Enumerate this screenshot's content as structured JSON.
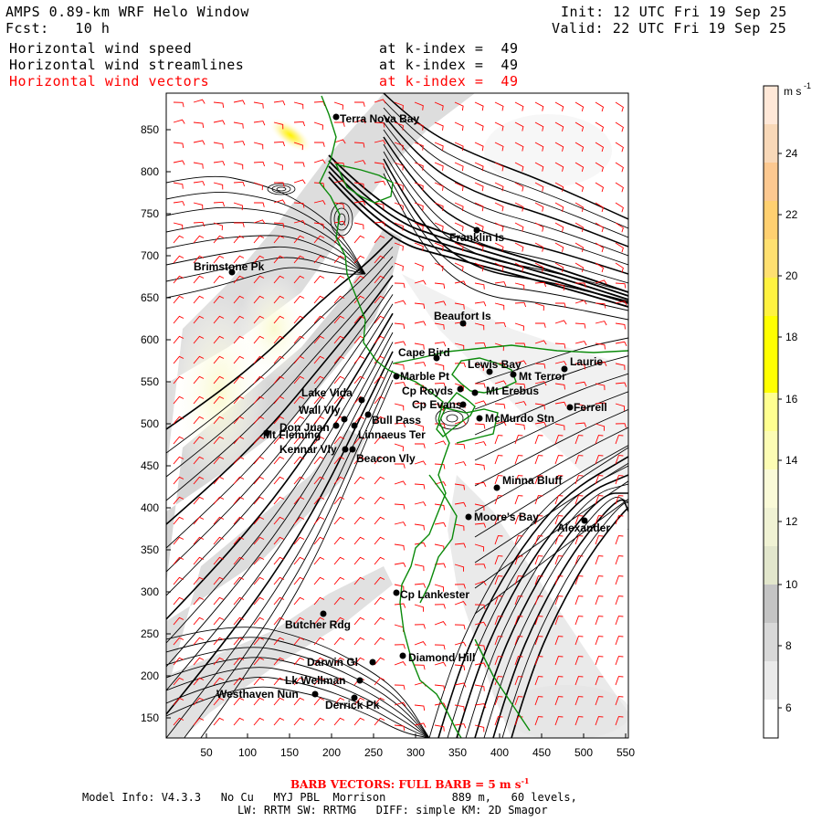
{
  "header": {
    "title": "AMPS 0.89-km WRF Helo Window",
    "forecast": "Fcst:   10 h",
    "init": "Init: 12 UTC Fri 19 Sep 25",
    "valid": "Valid: 22 UTC Fri 19 Sep 25",
    "layers": [
      {
        "name": "Horizontal wind speed",
        "level": "at k-index =  49"
      },
      {
        "name": "Horizontal wind streamlines",
        "level": "at k-index =  49"
      },
      {
        "name": "Horizontal wind vectors",
        "level": "at k-index =  49"
      }
    ]
  },
  "map": {
    "x_ticks": [
      "50",
      "100",
      "150",
      "200",
      "250",
      "300",
      "350",
      "400",
      "450",
      "500",
      "550"
    ],
    "y_ticks": [
      "850",
      "800",
      "750",
      "700",
      "650",
      "600",
      "550",
      "500",
      "450",
      "400",
      "350",
      "300",
      "250",
      "200",
      "150"
    ],
    "places": [
      {
        "name": "Terra Nova Bay"
      },
      {
        "name": "Franklin Is"
      },
      {
        "name": "Brimstone Pk"
      },
      {
        "name": "Beaufort Is"
      },
      {
        "name": "Cape Bird"
      },
      {
        "name": "Marble Pt"
      },
      {
        "name": "Lewis Bay"
      },
      {
        "name": "Mt Terror"
      },
      {
        "name": "Laurie"
      },
      {
        "name": "Cp Royds"
      },
      {
        "name": "Mt Erebus"
      },
      {
        "name": "Lake Vida"
      },
      {
        "name": "Cp Evans"
      },
      {
        "name": "Ferrell"
      },
      {
        "name": "Wall Vly"
      },
      {
        "name": "Bull Pass"
      },
      {
        "name": "McMurdo Stn"
      },
      {
        "name": "Don Juan"
      },
      {
        "name": "Mt Fleming"
      },
      {
        "name": "Linnaeus Ter"
      },
      {
        "name": "Kennar Vly"
      },
      {
        "name": "Beacon Vly"
      },
      {
        "name": "Minna Bluff"
      },
      {
        "name": "Moore's Bay"
      },
      {
        "name": "Alexander"
      },
      {
        "name": "Cp Lankester"
      },
      {
        "name": "Butcher Rdg"
      },
      {
        "name": "Diamond Hill"
      },
      {
        "name": "Darwin Gl"
      },
      {
        "name": "Lk Wellman"
      },
      {
        "name": "Westhaven Nun"
      },
      {
        "name": "Derrick Pk"
      }
    ]
  },
  "colorbar": {
    "units": "m s",
    "units_exp": "-1",
    "ticks": [
      "24",
      "22",
      "20",
      "18",
      "16",
      "14",
      "12",
      "10",
      "8",
      "6"
    ],
    "colors": [
      "#ffffff",
      "#eaeaea",
      "#d8d8d8",
      "#c4c4c4",
      "#e2e6cc",
      "#f0f2d4",
      "#fafad8",
      "#fcfcb4",
      "#ffff90",
      "#ffff00",
      "#ffff00",
      "#fff240",
      "#ffe070",
      "#ffd070",
      "#fcc890",
      "#f8d8b8",
      "#ffe8d8"
    ]
  },
  "footer": {
    "barb_vectors": "BARB VECTORS:  FULL BARB = 5 m s",
    "barb_exp": "-1",
    "model_info": "Model Info: V4.3.3   No Cu   MYJ PBL  Morrison          889 m,   60 levels,",
    "physics": "LW: RRTM SW: RRTMG   DIFF: simple KM: 2D Smagor"
  },
  "colors": {
    "coast": "#0a8a0a",
    "barbs": "#ff0000",
    "streamlines": "#000000"
  }
}
